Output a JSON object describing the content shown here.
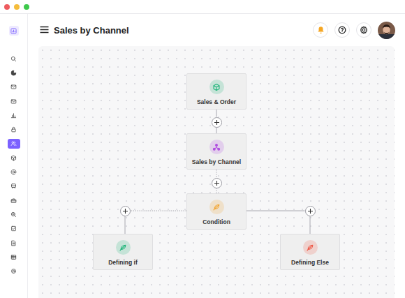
{
  "window": {
    "controls": [
      {
        "color": "#ee5b5f"
      },
      {
        "color": "#f5bd3c"
      },
      {
        "color": "#3ec94c"
      }
    ]
  },
  "header": {
    "title": "Sales by Channel"
  },
  "sidebar": {
    "items": [
      {
        "selected": false
      },
      {
        "selected": false
      },
      {
        "selected": false
      },
      {
        "selected": false
      },
      {
        "selected": false
      },
      {
        "selected": false
      },
      {
        "selected": true
      },
      {
        "selected": false
      },
      {
        "selected": false
      },
      {
        "selected": false
      },
      {
        "selected": false
      },
      {
        "selected": false
      },
      {
        "selected": false
      },
      {
        "selected": false
      },
      {
        "selected": false
      },
      {
        "selected": false
      }
    ]
  },
  "flow": {
    "nodes": [
      {
        "label": "Sales & Order",
        "kind": "order",
        "color": "#1fb57a"
      },
      {
        "label": "Sales by Channel",
        "kind": "channel",
        "color": "#b04de0"
      },
      {
        "label": "Condition",
        "kind": "condition",
        "color": "#f2a531"
      },
      {
        "label": "Defining if",
        "kind": "branch",
        "color": "#1fb57a"
      },
      {
        "label": "Defining Else",
        "kind": "branch",
        "color": "#ee5a48"
      }
    ]
  }
}
